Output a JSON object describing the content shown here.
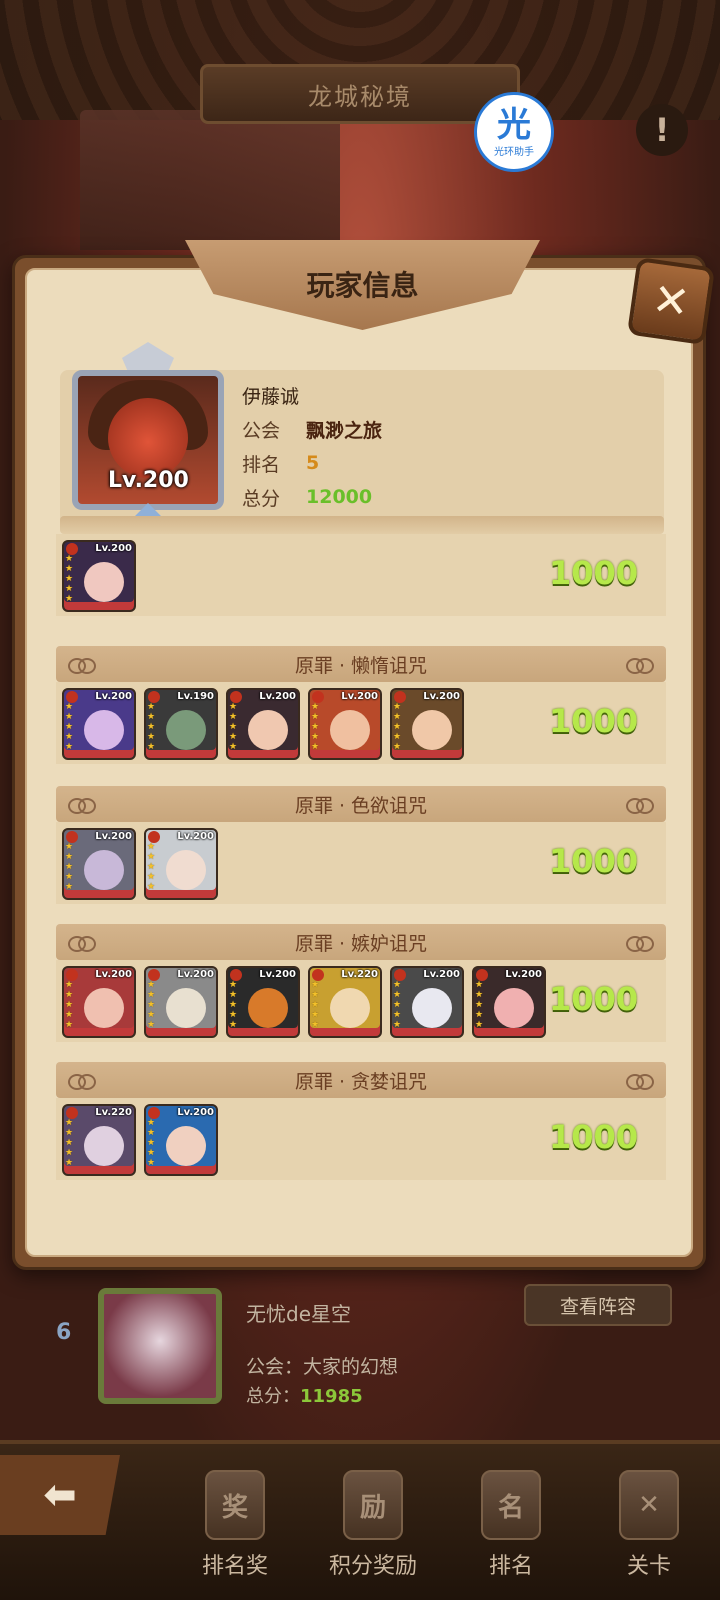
{
  "scene": {
    "title": "龙城秘境",
    "watermark": {
      "glyph": "光",
      "text": "光环助手"
    },
    "info_icon": "!"
  },
  "modal": {
    "title": "玩家信息",
    "close_glyph": "✕",
    "player": {
      "name": "伊藤诚",
      "level": "Lv.200",
      "guild_label": "公会",
      "guild": "飘渺之旅",
      "rank_label": "排名",
      "rank": "5",
      "score_label": "总分",
      "score": "12000"
    },
    "sections": [
      {
        "title": "",
        "score": "1000",
        "heroes": [
          {
            "level": "Lv.200",
            "color": "#3a2a4a",
            "face": "#f0c8c0"
          }
        ]
      },
      {
        "title": "原罪 · 懒惰诅咒",
        "score": "1000",
        "heroes": [
          {
            "level": "Lv.200",
            "color": "#4a3a8a",
            "face": "#d8b8e8"
          },
          {
            "level": "Lv.190",
            "color": "#3a3a3a",
            "face": "#7a9a7a"
          },
          {
            "level": "Lv.200",
            "color": "#3a2a30",
            "face": "#f0c8b0"
          },
          {
            "level": "Lv.200",
            "color": "#b84a2a",
            "face": "#f0c0a0"
          },
          {
            "level": "Lv.200",
            "color": "#6a4a2a",
            "face": "#f0c8a8"
          }
        ]
      },
      {
        "title": "原罪 · 色欲诅咒",
        "score": "1000",
        "heroes": [
          {
            "level": "Lv.200",
            "color": "#6a6a7a",
            "face": "#c8b8d8"
          },
          {
            "level": "Lv.200",
            "color": "#c8ccd0",
            "face": "#f0dcd0"
          }
        ]
      },
      {
        "title": "原罪 · 嫉妒诅咒",
        "score": "1000",
        "heroes": [
          {
            "level": "Lv.200",
            "color": "#a83a3a",
            "face": "#f0c0b0"
          },
          {
            "level": "Lv.200",
            "color": "#8a8a8a",
            "face": "#e8e0d0"
          },
          {
            "level": "Lv.200",
            "color": "#2a2a2a",
            "face": "#d87a2a"
          },
          {
            "level": "Lv.220",
            "color": "#c8a030",
            "face": "#f0d8b0"
          },
          {
            "level": "Lv.200",
            "color": "#4a4a4a",
            "face": "#e8e8f0"
          },
          {
            "level": "Lv.200",
            "color": "#3a2a2a",
            "face": "#f0b0b0"
          }
        ]
      },
      {
        "title": "原罪 · 贪婪诅咒",
        "score": "1000",
        "heroes": [
          {
            "level": "Lv.220",
            "color": "#5a4a6a",
            "face": "#e0d0e0"
          },
          {
            "level": "Lv.200",
            "color": "#2a6ab0",
            "face": "#f0d0c0"
          }
        ]
      }
    ]
  },
  "list_item": {
    "rank": "6",
    "name": "无忧de星空",
    "guild_line": "公会：大家的幻想",
    "score_label": "总分：",
    "score": "11985",
    "button": "查看阵容"
  },
  "nav": {
    "back_glyph": "⬅",
    "tabs": [
      {
        "label": "排名奖",
        "glyph": "奖"
      },
      {
        "label": "积分奖励",
        "glyph": "励"
      },
      {
        "label": "排名",
        "glyph": "名"
      },
      {
        "label": "关卡",
        "glyph": "✕"
      }
    ]
  },
  "colors": {
    "score_green": "#b6e84a",
    "rank_orange": "#d58a1a",
    "parchment": "#ecdcbc"
  }
}
